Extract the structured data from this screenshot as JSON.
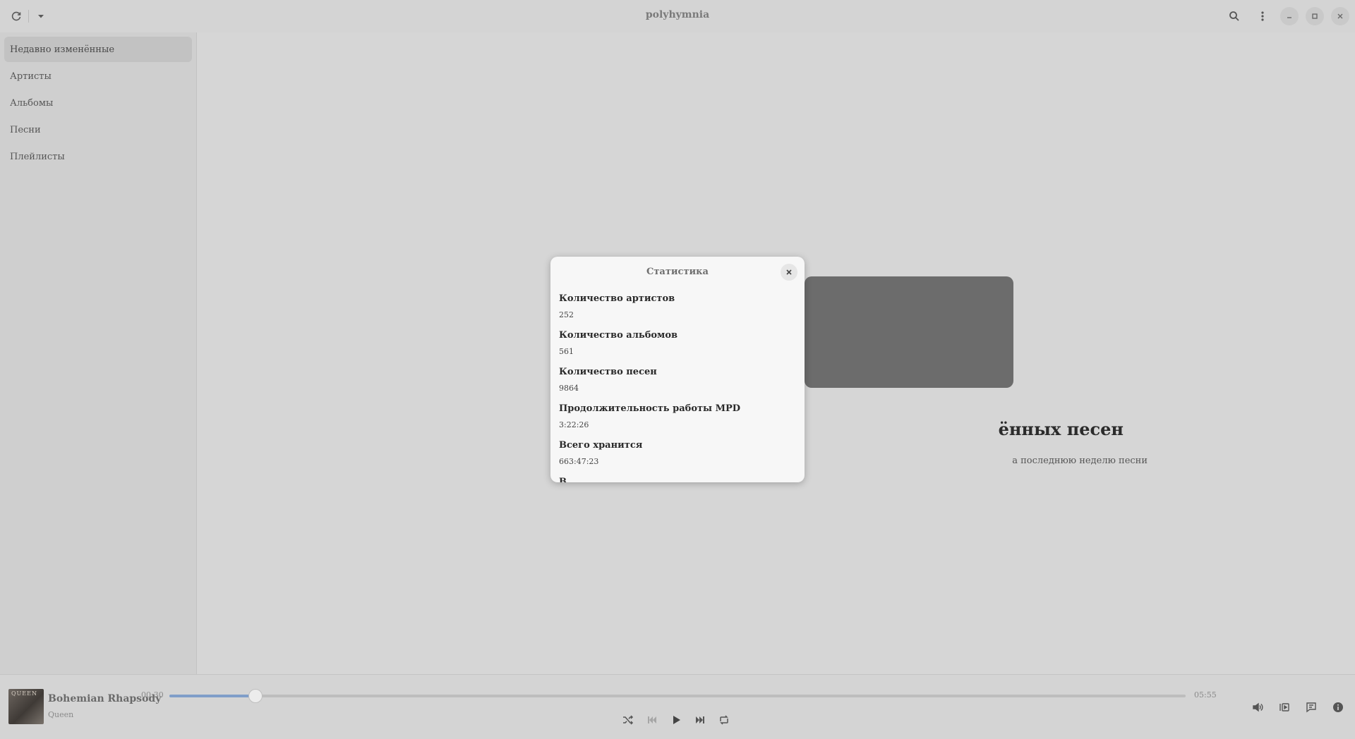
{
  "header": {
    "title": "polyhymnia",
    "refresh_icon": "refresh-icon",
    "dropdown_icon": "chevron-down-icon",
    "search_icon": "search-icon",
    "menu_icon": "kebab-menu-icon"
  },
  "sidebar": {
    "items": [
      {
        "label": "Недавно изменённые",
        "active": true
      },
      {
        "label": "Артисты",
        "active": false
      },
      {
        "label": "Альбомы",
        "active": false
      },
      {
        "label": "Песни",
        "active": false
      },
      {
        "label": "Плейлисты",
        "active": false
      }
    ]
  },
  "main": {
    "empty_title": "ённых песен",
    "empty_subtitle": "а последнюю неделю песни"
  },
  "dialog": {
    "title": "Статистика",
    "stats": [
      {
        "label": "Количество артистов",
        "value": "252"
      },
      {
        "label": "Количество альбомов",
        "value": "561"
      },
      {
        "label": "Количество песен",
        "value": "9864"
      },
      {
        "label": "Продолжительность работы MPD",
        "value": "3:22:26"
      },
      {
        "label": "Всего хранится",
        "value": "663:47:23"
      },
      {
        "label": "В",
        "value": ""
      }
    ]
  },
  "player": {
    "cover_text": "QUEEN",
    "track_title": "Bohemian Rhapsody",
    "track_artist": "Queen",
    "time_current": "00:30",
    "time_total": "05:55",
    "progress": 0.085,
    "accent_color": "#7f9ec9"
  }
}
